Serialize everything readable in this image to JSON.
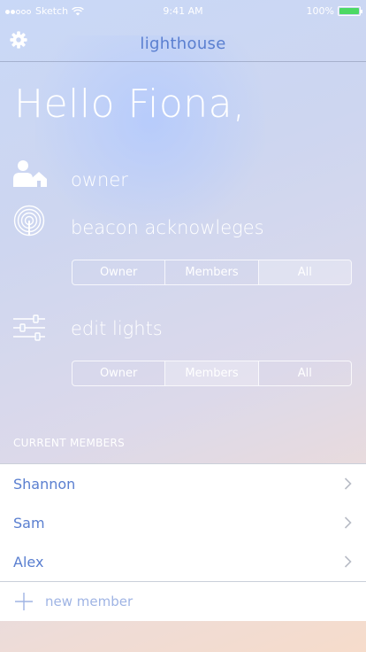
{
  "status_bar": {
    "carrier": "Sketch",
    "time": "9:41 AM",
    "battery": "100%"
  },
  "nav": {
    "title": "lighthouse",
    "settings_icon": "gear-icon"
  },
  "greeting": "Hello Fiona,",
  "owner_row": {
    "label": "owner",
    "icon": "owner-home-icon"
  },
  "beacon_row": {
    "label": "beacon acknowleges",
    "icon": "beacon-icon",
    "options": [
      "Owner",
      "Members",
      "All"
    ],
    "selected": "All"
  },
  "lights_row": {
    "label": "edit lights",
    "icon": "sliders-icon",
    "options": [
      "Owner",
      "Members",
      "All"
    ],
    "selected": "Members"
  },
  "members": {
    "header": "CURRENT MEMBERS",
    "items": [
      {
        "name": "Shannon"
      },
      {
        "name": "Sam"
      },
      {
        "name": "Alex"
      }
    ],
    "new_member_label": "new member"
  },
  "colors": {
    "accent": "#5a7fd0",
    "battery": "#4cd964"
  }
}
